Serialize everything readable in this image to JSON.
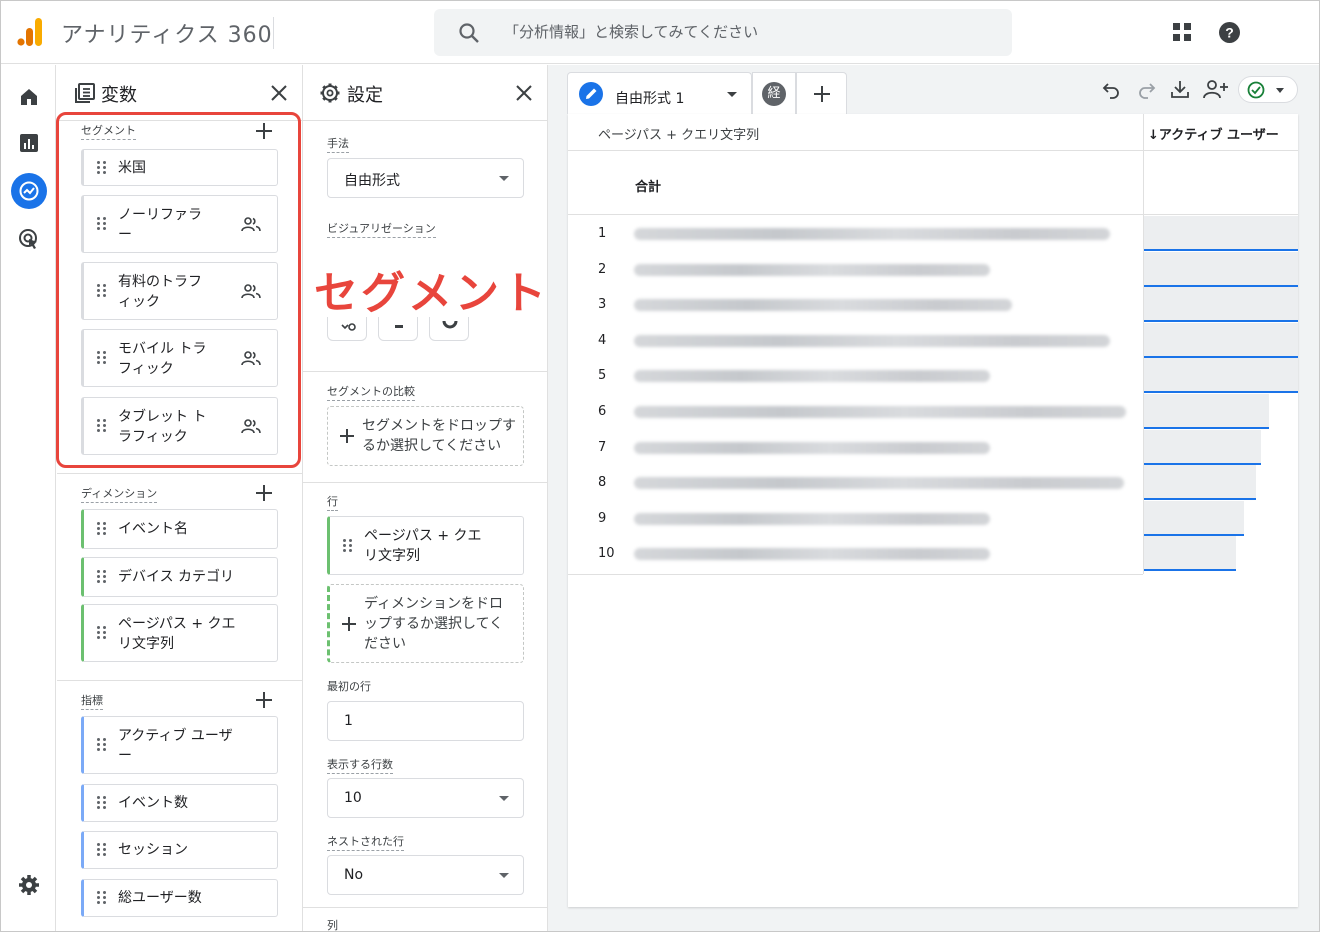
{
  "header": {
    "app_title": "アナリティクス 360",
    "search_placeholder": "「分析情報」と検索してみてください"
  },
  "variables_panel": {
    "title": "変数",
    "segments_label": "セグメント",
    "segments": [
      {
        "label": "米国"
      },
      {
        "label": "ノーリファラ\nー"
      },
      {
        "label": "有料のトラフ\nィック"
      },
      {
        "label": "モバイル トラ\nフィック"
      },
      {
        "label": "タブレット ト\nラフィック"
      }
    ],
    "dimensions_label": "ディメンション",
    "dimensions": [
      {
        "label": "イベント名"
      },
      {
        "label": "デバイス カテゴリ"
      },
      {
        "label": "ページパス + クエ\nリ文字列"
      }
    ],
    "metrics_label": "指標",
    "metrics": [
      {
        "label": "アクティブ ユーザ\nー"
      },
      {
        "label": "イベント数"
      },
      {
        "label": "セッション"
      },
      {
        "label": "総ユーザー数"
      }
    ]
  },
  "settings_panel": {
    "title": "設定",
    "technique_label": "手法",
    "technique_value": "自由形式",
    "visualization_label": "ビジュアリゼーション",
    "segment_compare_label": "セグメントの比較",
    "segment_drop_text": "セグメントをドロップす\nるか選択してください",
    "rows_label": "行",
    "row_chip": "ページパス + クエ\nリ文字列",
    "dimension_drop_text": "ディメンションをドロ\nップするか選択してく\nださい",
    "first_row_label": "最初の行",
    "first_row_value": "1",
    "show_rows_label": "表示する行数",
    "show_rows_value": "10",
    "nested_rows_label": "ネストされた行",
    "nested_rows_value": "No",
    "columns_label": "列"
  },
  "annotation": {
    "callout_text": "セグメント",
    "color": "#e8453c"
  },
  "canvas": {
    "tab_label": "自由形式 1",
    "tab2_glyph": "経",
    "dimension_header": "ページパス + クエリ文字列",
    "metric_header": "↓アクティブ ユーザー",
    "total_label": "合計",
    "rows": [
      {
        "n": "1",
        "bar": 1.0
      },
      {
        "n": "2",
        "bar": 1.0
      },
      {
        "n": "3",
        "bar": 1.0
      },
      {
        "n": "4",
        "bar": 1.0
      },
      {
        "n": "5",
        "bar": 1.0
      },
      {
        "n": "6",
        "bar": 0.81
      },
      {
        "n": "7",
        "bar": 0.76
      },
      {
        "n": "8",
        "bar": 0.73
      },
      {
        "n": "9",
        "bar": 0.65
      },
      {
        "n": "10",
        "bar": 0.6
      }
    ]
  },
  "colors": {
    "accent": "#1a73e8",
    "dimension": "#6cc070",
    "metric": "#7baaf7",
    "logo_orange": "#f9ab00",
    "logo_dark": "#e37400"
  }
}
